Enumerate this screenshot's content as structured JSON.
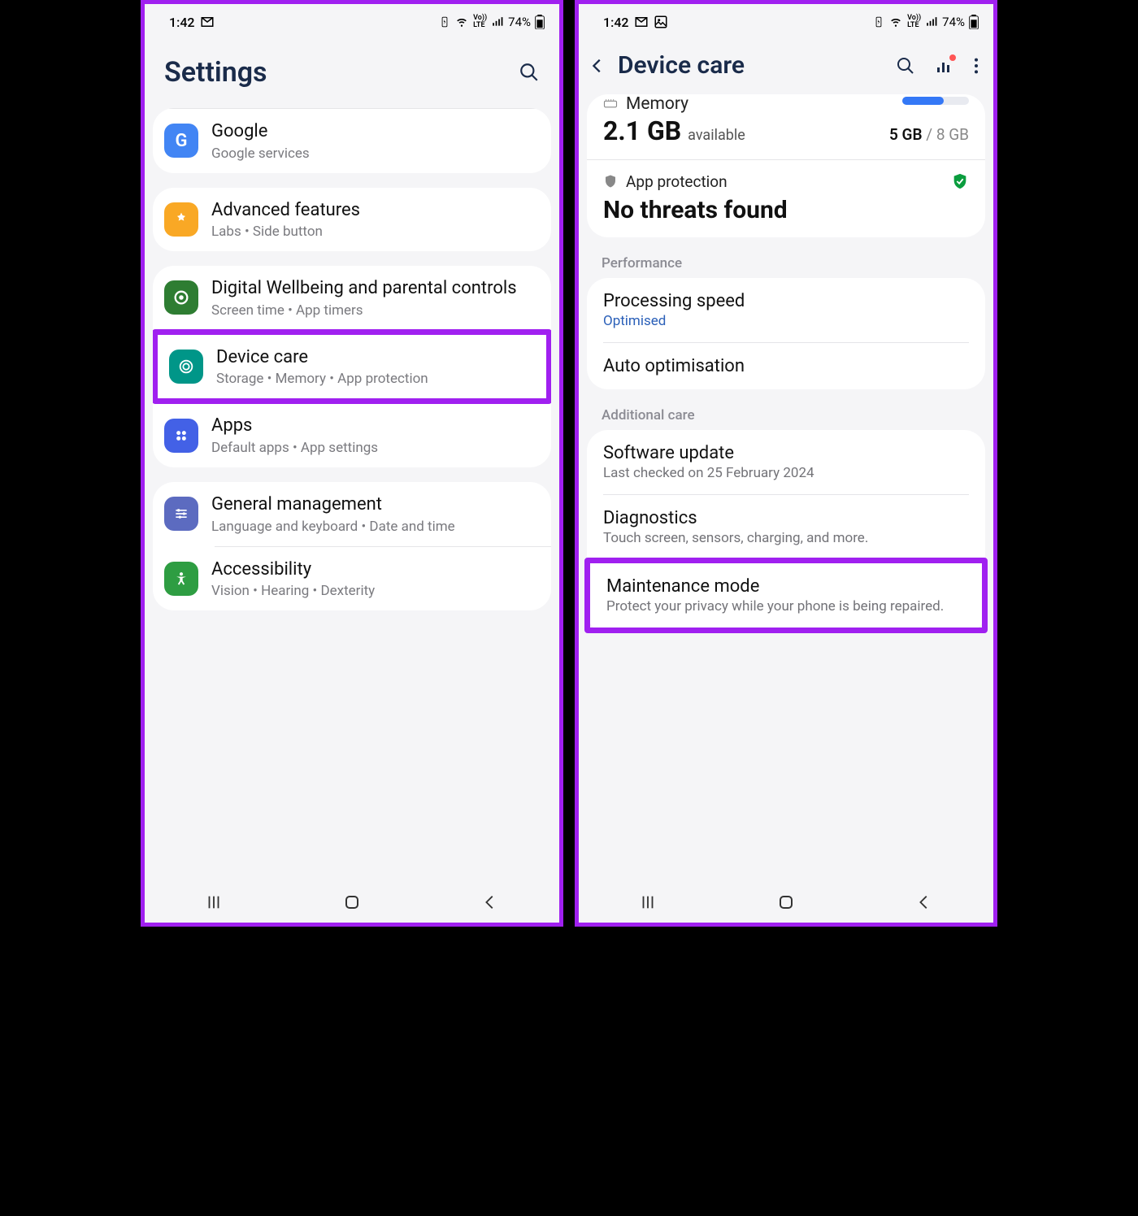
{
  "status": {
    "time": "1:42",
    "battery_pct": "74%"
  },
  "settings": {
    "title": "Settings",
    "google": {
      "title": "Google",
      "sub": "Google services"
    },
    "advanced": {
      "title": "Advanced features",
      "sub": "Labs  •  Side button"
    },
    "dwb": {
      "title": "Digital Wellbeing and parental controls",
      "sub": "Screen time  •  App timers"
    },
    "devicecare": {
      "title": "Device care",
      "sub": "Storage  •  Memory  •  App protection"
    },
    "apps": {
      "title": "Apps",
      "sub": "Default apps  •  App settings"
    },
    "general": {
      "title": "General management",
      "sub": "Language and keyboard  •  Date and time"
    },
    "accessibility": {
      "title": "Accessibility",
      "sub": "Vision  •  Hearing  •  Dexterity"
    }
  },
  "dc": {
    "title": "Device care",
    "memory_header": "Memory",
    "memory_val": "2.1 GB",
    "memory_avail": "available",
    "memory_used": "5 GB",
    "memory_total": " / 8 GB",
    "app_prot": "App protection",
    "threats": "No threats found",
    "performance_header": "Performance",
    "proc_speed": {
      "title": "Processing speed",
      "sub": "Optimised"
    },
    "auto_opt": {
      "title": "Auto optimisation"
    },
    "additional_header": "Additional care",
    "software": {
      "title": "Software update",
      "sub": "Last checked on 25 February 2024"
    },
    "diag": {
      "title": "Diagnostics",
      "sub": "Touch screen, sensors, charging, and more."
    },
    "maint": {
      "title": "Maintenance mode",
      "sub": "Protect your privacy while your phone is being repaired."
    }
  }
}
